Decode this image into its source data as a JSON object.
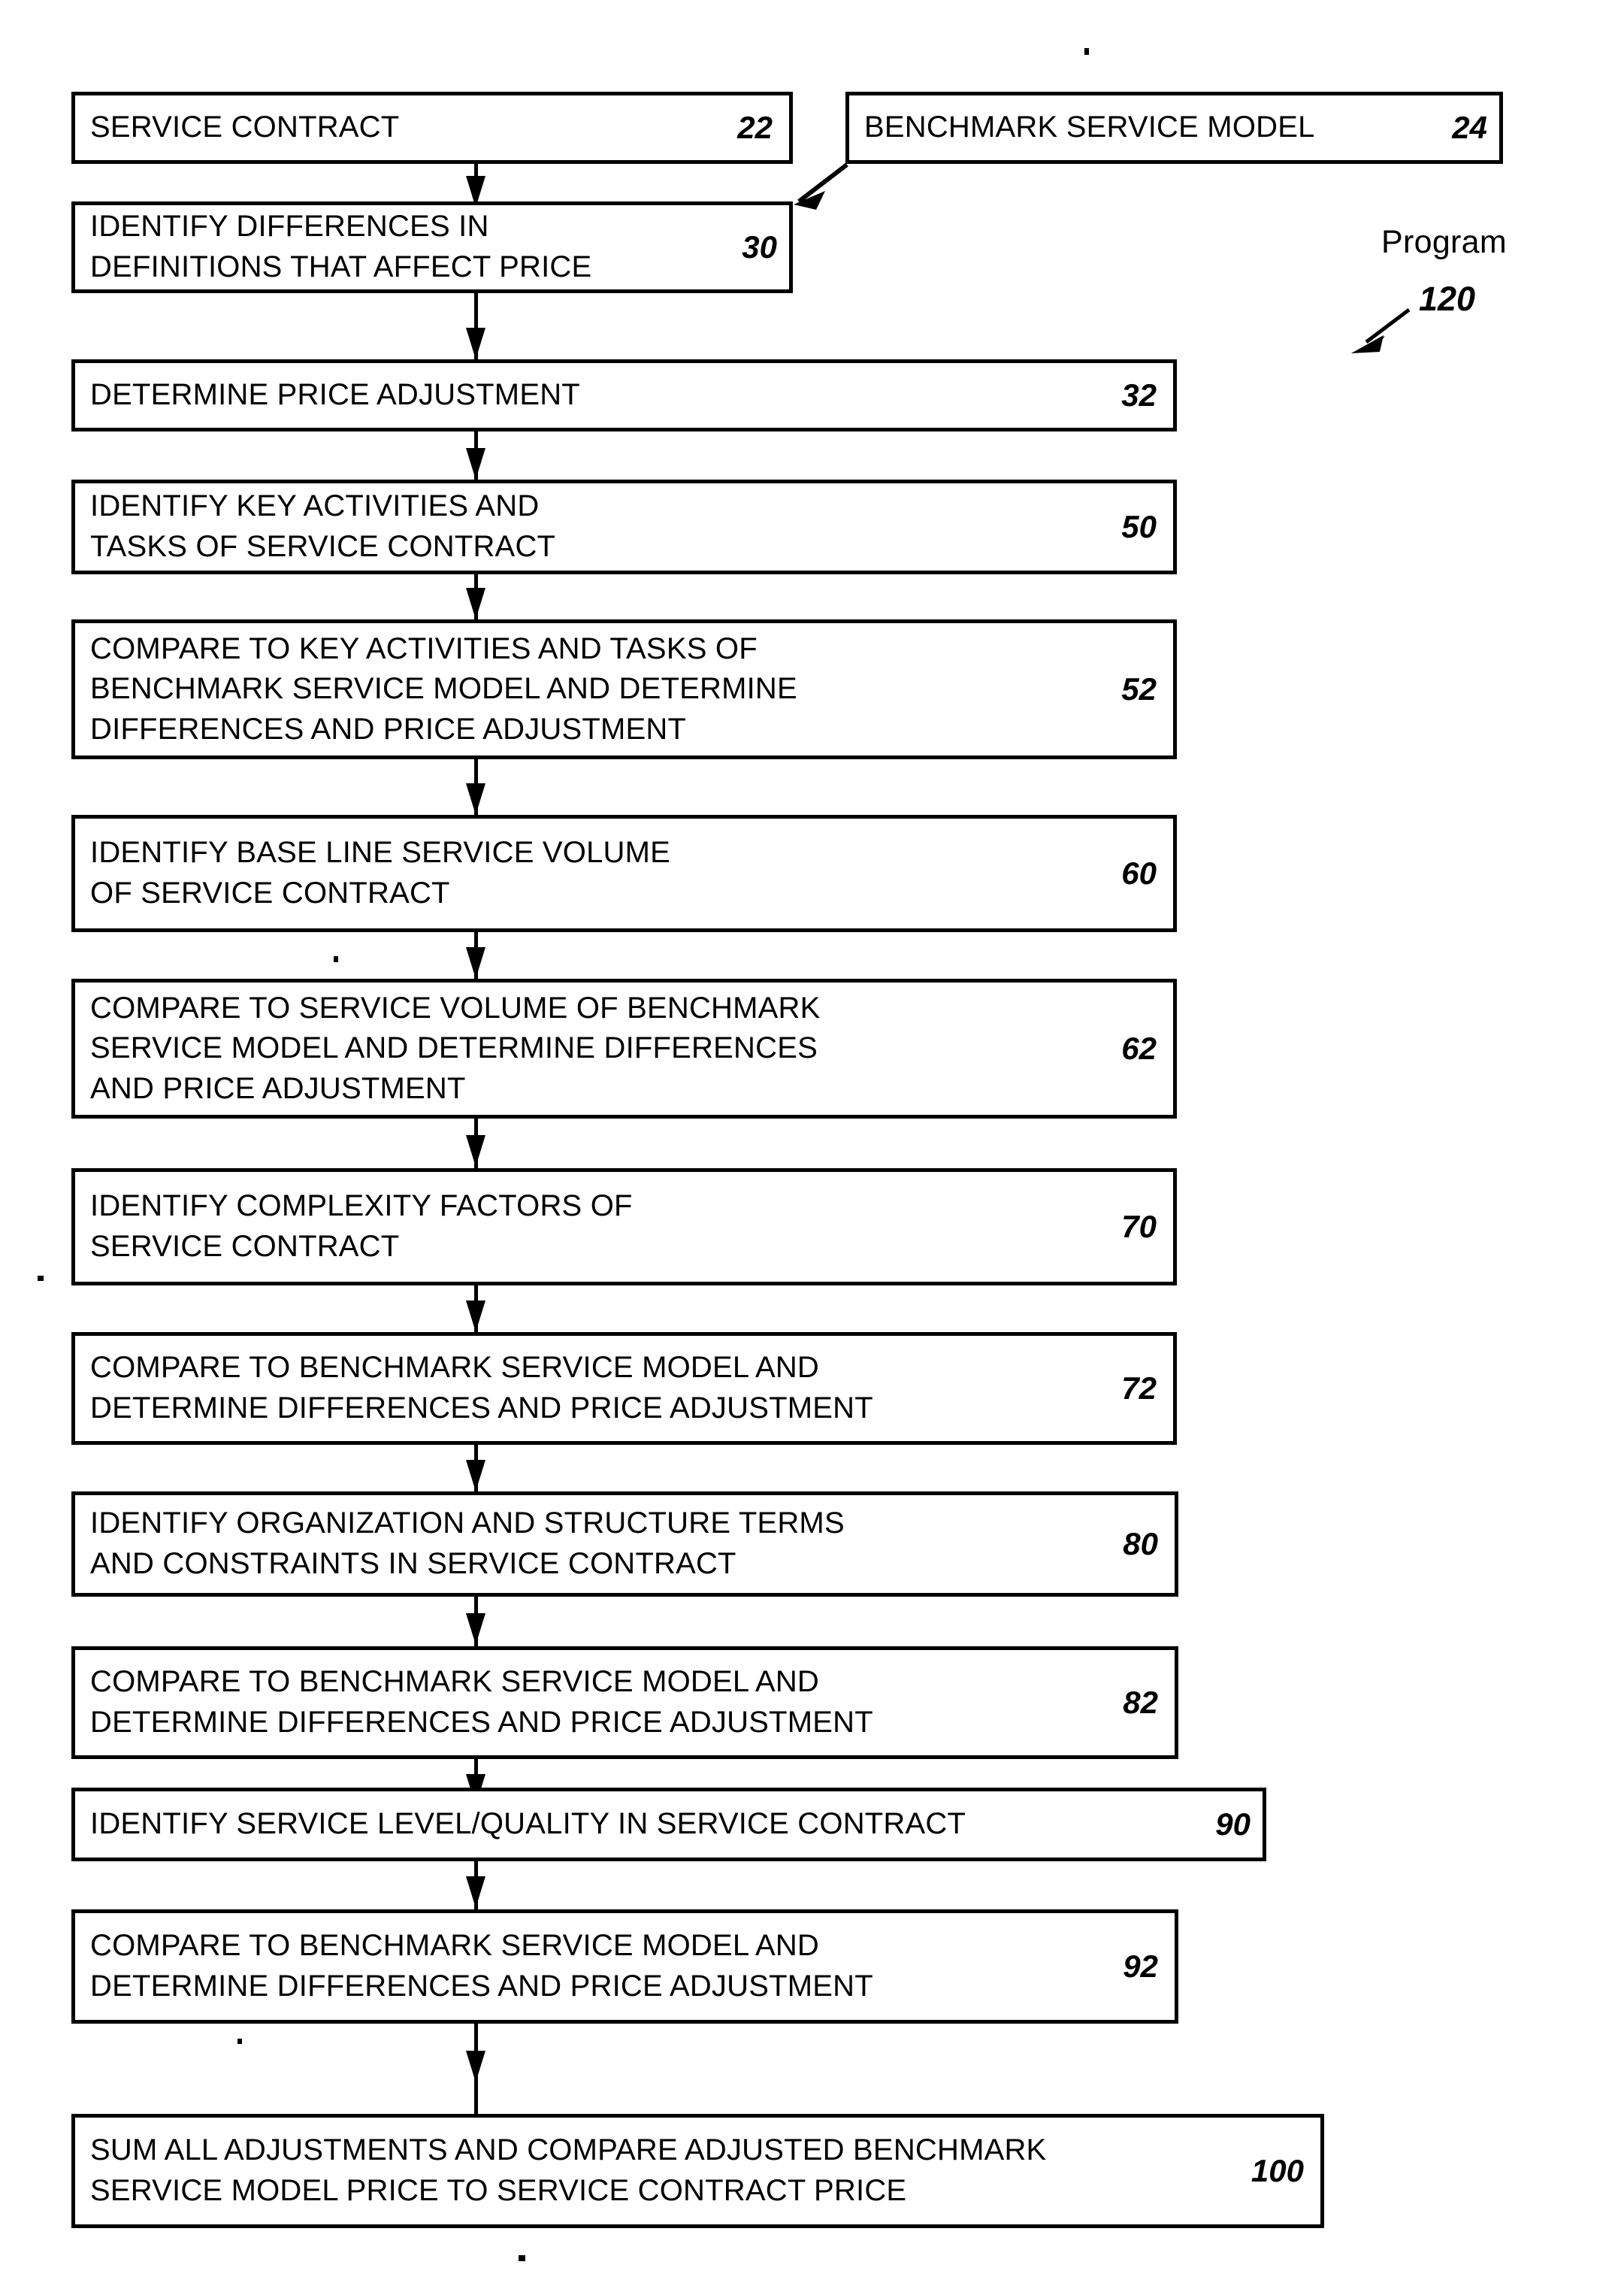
{
  "figure": {
    "callout": {
      "label": "Program",
      "number": "120"
    },
    "nodes": [
      {
        "id": "n22",
        "text": "SERVICE CONTRACT",
        "number": "22",
        "number_style": "right-center"
      },
      {
        "id": "n24",
        "text": "BENCHMARK SERVICE MODEL",
        "number": "24",
        "number_style": "inline"
      },
      {
        "id": "n30",
        "text": "IDENTIFY DIFFERENCES IN\nDEFINITIONS THAT AFFECT PRICE",
        "number": "30",
        "number_style": "inline"
      },
      {
        "id": "n32",
        "text": "DETERMINE PRICE ADJUSTMENT",
        "number": "32",
        "number_style": "right-center"
      },
      {
        "id": "n50",
        "text": "IDENTIFY KEY ACTIVITIES AND\nTASKS OF SERVICE CONTRACT",
        "number": "50",
        "number_style": "right-center"
      },
      {
        "id": "n52",
        "text": "COMPARE TO KEY ACTIVITIES AND TASKS OF\nBENCHMARK SERVICE MODEL AND DETERMINE\nDIFFERENCES AND PRICE ADJUSTMENT",
        "number": "52",
        "number_style": "right-center"
      },
      {
        "id": "n60",
        "text": "IDENTIFY BASE LINE SERVICE VOLUME\nOF SERVICE CONTRACT",
        "number": "60",
        "number_style": "right-center"
      },
      {
        "id": "n62",
        "text": "COMPARE TO SERVICE VOLUME OF BENCHMARK\nSERVICE MODEL AND DETERMINE DIFFERENCES\nAND PRICE ADJUSTMENT",
        "number": "62",
        "number_style": "right-center"
      },
      {
        "id": "n70",
        "text": "IDENTIFY COMPLEXITY FACTORS OF\nSERVICE CONTRACT",
        "number": "70",
        "number_style": "right-center"
      },
      {
        "id": "n72",
        "text": "COMPARE TO BENCHMARK SERVICE MODEL AND\nDETERMINE DIFFERENCES AND PRICE ADJUSTMENT",
        "number": "72",
        "number_style": "right-center"
      },
      {
        "id": "n80",
        "text": "IDENTIFY ORGANIZATION AND STRUCTURE TERMS\nAND CONSTRAINTS IN SERVICE CONTRACT",
        "number": "80",
        "number_style": "right-center"
      },
      {
        "id": "n82",
        "text": "COMPARE TO BENCHMARK SERVICE MODEL AND\nDETERMINE DIFFERENCES AND PRICE ADJUSTMENT",
        "number": "82",
        "number_style": "right-center"
      },
      {
        "id": "n90",
        "text": "IDENTIFY SERVICE LEVEL/QUALITY IN SERVICE CONTRACT",
        "number": "90",
        "number_style": "inline"
      },
      {
        "id": "n92",
        "text": "COMPARE TO BENCHMARK SERVICE MODEL AND\nDETERMINE DIFFERENCES AND PRICE ADJUSTMENT",
        "number": "92",
        "number_style": "right-center"
      },
      {
        "id": "n100",
        "text": "SUM ALL ADJUSTMENTS AND COMPARE ADJUSTED BENCHMARK\nSERVICE MODEL PRICE TO SERVICE CONTRACT PRICE",
        "number": "100",
        "number_style": "right-center"
      }
    ]
  }
}
